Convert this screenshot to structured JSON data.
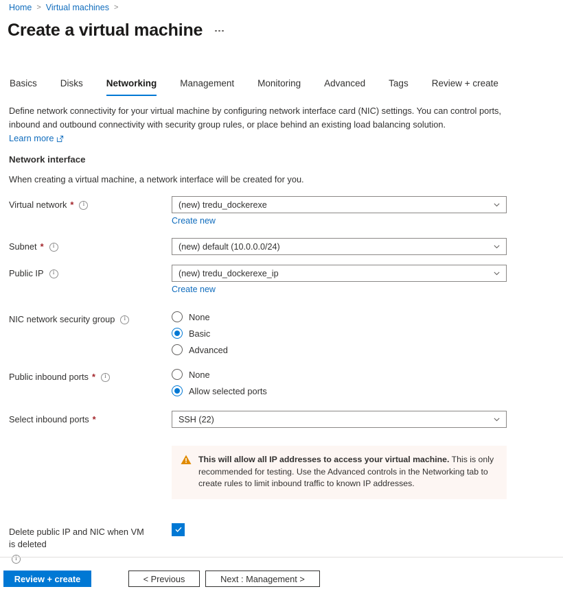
{
  "breadcrumb": {
    "items": [
      {
        "label": "Home",
        "link": true
      },
      {
        "label": "Virtual machines",
        "link": true
      }
    ],
    "separator": ">"
  },
  "header": {
    "title": "Create a virtual machine",
    "more_label": "More options"
  },
  "tabs": [
    {
      "label": "Basics",
      "active": false
    },
    {
      "label": "Disks",
      "active": false
    },
    {
      "label": "Networking",
      "active": true
    },
    {
      "label": "Management",
      "active": false
    },
    {
      "label": "Monitoring",
      "active": false
    },
    {
      "label": "Advanced",
      "active": false
    },
    {
      "label": "Tags",
      "active": false
    },
    {
      "label": "Review + create",
      "active": false
    }
  ],
  "intro": {
    "paragraph": "Define network connectivity for your virtual machine by configuring network interface card (NIC) settings. You can control ports, inbound and outbound connectivity with security group rules, or place behind an existing load balancing solution.",
    "learn_more": "Learn more"
  },
  "network_interface": {
    "heading": "Network interface",
    "subtext": "When creating a virtual machine, a network interface will be created for you."
  },
  "fields": {
    "virtual_network": {
      "label": "Virtual network",
      "required": "*",
      "value": "(new) tredu_dockerexe",
      "create_new": "Create new"
    },
    "subnet": {
      "label": "Subnet",
      "required": "*",
      "value": "(new) default (10.0.0.0/24)"
    },
    "public_ip": {
      "label": "Public IP",
      "value": "(new) tredu_dockerexe_ip",
      "create_new": "Create new"
    },
    "nic_nsg": {
      "label": "NIC network security group",
      "options": [
        {
          "label": "None",
          "selected": false
        },
        {
          "label": "Basic",
          "selected": true
        },
        {
          "label": "Advanced",
          "selected": false
        }
      ]
    },
    "public_inbound_ports": {
      "label": "Public inbound ports",
      "required": "*",
      "options": [
        {
          "label": "None",
          "selected": false
        },
        {
          "label": "Allow selected ports",
          "selected": true
        }
      ]
    },
    "select_inbound_ports": {
      "label": "Select inbound ports",
      "required": "*",
      "value": "SSH (22)"
    },
    "delete_public_ip": {
      "label": "Delete public IP and NIC when VM is deleted",
      "checked": true
    }
  },
  "warning": {
    "bold_text": "This will allow all IP addresses to access your virtual machine.",
    "body_text": " This is only recommended for testing.  Use the Advanced controls in the Networking tab to create rules to limit inbound traffic to known IP addresses."
  },
  "footer": {
    "review_create": "Review + create",
    "previous": "< Previous",
    "next": "Next : Management >"
  },
  "colors": {
    "accent": "#0078d4",
    "link": "#0f6cbd",
    "required": "#a4262c",
    "warning_bg": "#fdf6f3",
    "warning_icon": "#e08a00"
  }
}
